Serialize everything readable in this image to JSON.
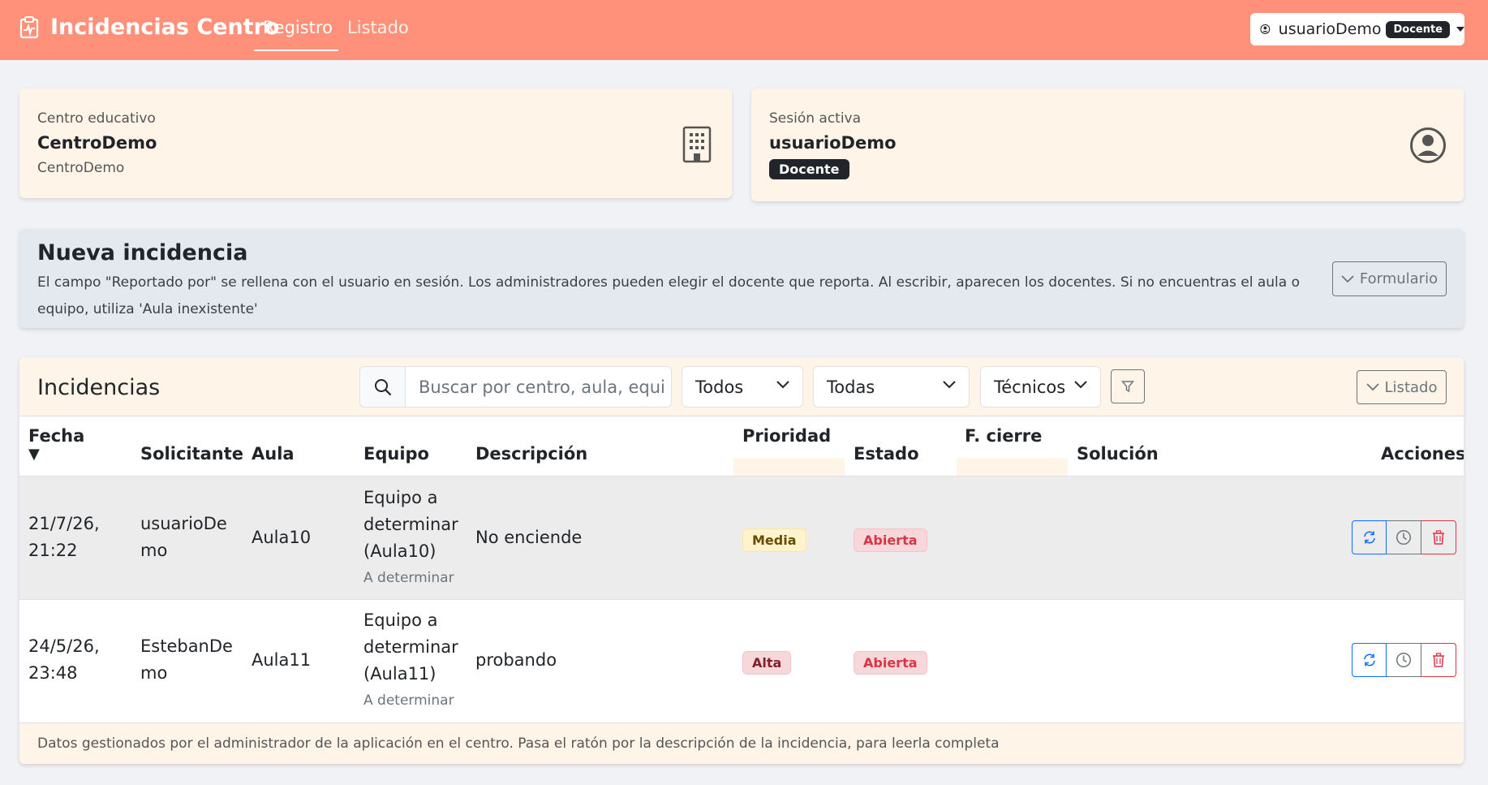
{
  "navbar": {
    "brand": "Incidencias Centro",
    "links": [
      "Registro",
      "Listado"
    ],
    "active_link": "Registro",
    "user": {
      "name": "usuarioDemo",
      "role_badge": "Docente"
    }
  },
  "centro_card": {
    "label": "Centro educativo",
    "title": "CentroDemo",
    "subtitle": "CentroDemo",
    "icon": "building-icon"
  },
  "sesion_card": {
    "label": "Sesión activa",
    "title": "usuarioDemo",
    "badge": "Docente",
    "icon": "person-circle-icon"
  },
  "nueva": {
    "title": "Nueva incidencia",
    "description": "El campo \"Reportado por\" se rellena con el usuario en sesión. Los administradores pueden elegir el docente que reporta. Al escribir, aparecen los docentes. Si no encuentras el aula o equipo, utiliza 'Aula inexistente'",
    "button": "Formulario"
  },
  "incidencias": {
    "title": "Incidencias",
    "search_placeholder": "Buscar por centro, aula, equi",
    "filters": [
      "Todos",
      "Todas",
      "Técnicos"
    ],
    "listado_button": "Listado",
    "columns": {
      "fecha": "Fecha",
      "sort_arrow": "▼",
      "solicitante": "Solicitante",
      "aula": "Aula",
      "equipo": "Equipo",
      "descripcion": "Descripción",
      "prioridad": "Prioridad",
      "estado": "Estado",
      "fcierre": "F. cierre",
      "solucion": "Solución",
      "acciones": "Acciones"
    },
    "rows": [
      {
        "fecha_1": "21/7/26,",
        "fecha_2": "21:22",
        "solicitante_1": "usuarioDe",
        "solicitante_2": "mo",
        "aula": "Aula10",
        "equipo_1": "Equipo a",
        "equipo_2": "determinar",
        "equipo_3": "(Aula10)",
        "equipo_sub": "A determinar",
        "descripcion": "No enciende",
        "prioridad": "Media",
        "estado": "Abierta",
        "fcierre": "",
        "solucion": ""
      },
      {
        "fecha_1": "24/5/26,",
        "fecha_2": "23:48",
        "solicitante_1": "EstebanDe",
        "solicitante_2": "mo",
        "aula": "Aula11",
        "equipo_1": "Equipo a",
        "equipo_2": "determinar",
        "equipo_3": "(Aula11)",
        "equipo_sub": "A determinar",
        "descripcion": "probando",
        "prioridad": "Alta",
        "estado": "Abierta",
        "fcierre": "",
        "solucion": ""
      }
    ],
    "footer": "Datos gestionados por el administrador de la aplicación en el centro. Pasa el ratón por la descripción de la incidencia, para leerla completa"
  },
  "colors": {
    "navbar": "#ff917a",
    "card_bg": "#fef4e8",
    "nueva_bg": "#e4e9f0",
    "primary": "#0d6efd",
    "danger": "#dc3545",
    "warning": "#fff3cd"
  }
}
